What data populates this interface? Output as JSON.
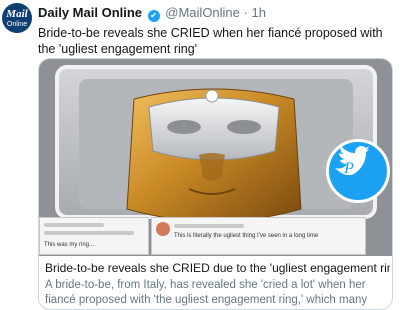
{
  "tweet": {
    "avatar_line1": "Mail",
    "avatar_line2": "Online",
    "display_name": "Daily Mail Online",
    "verified_mark": "✔",
    "handle": "@MailOnline",
    "separator": "·",
    "time": "1h",
    "text": "Bride-to-be reveals she CRIED when her fiancé proposed with the 'ugliest engagement ring'"
  },
  "card": {
    "comment_left": "This was my ring...",
    "comment_right": "This is literally the ugliest thing I've seen in a long time",
    "headline": "Bride-to-be reveals she CRIED due to the 'ugliest engagement ring'",
    "description": "A bride-to-be, from Italy, has revealed she 'cried a lot' when her fiancé proposed with 'the ugliest engagement ring,' which many have compar..."
  },
  "colors": {
    "brand_blue": "#1da1f2",
    "mail_navy": "#0f3e72",
    "gold": "#c98a25",
    "silver": "#d9dcdf"
  },
  "icons": [
    "verified-icon",
    "twitter-bird-icon",
    "p-logo-icon"
  ]
}
